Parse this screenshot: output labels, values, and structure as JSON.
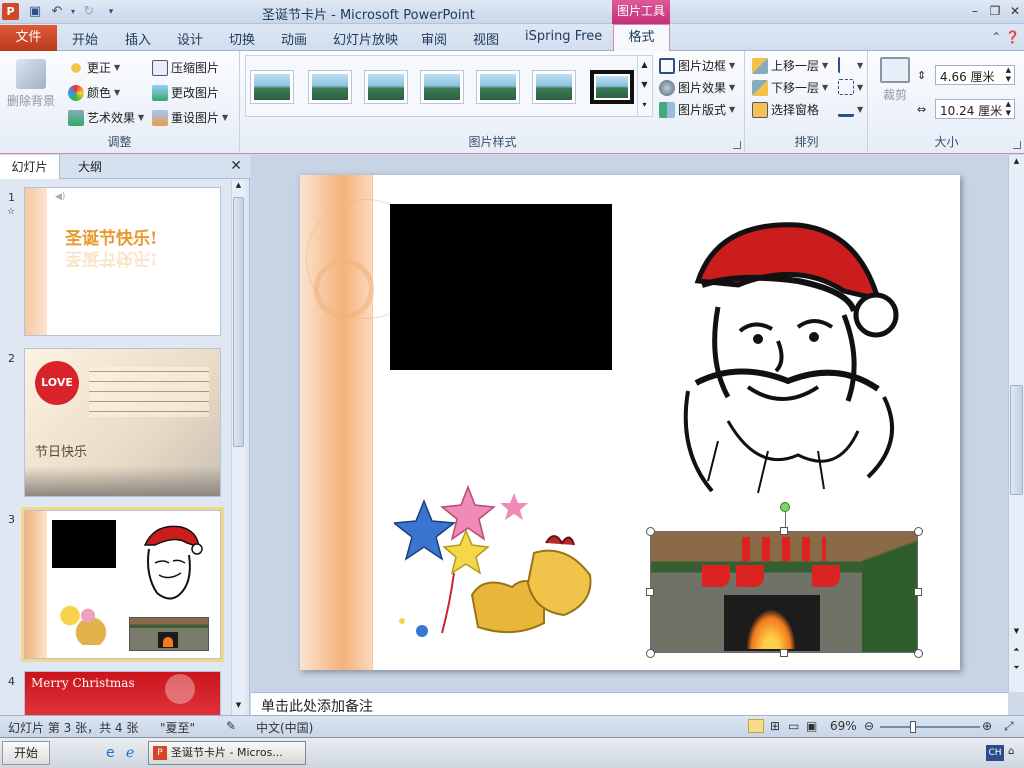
{
  "titlebar": {
    "window_title": "圣诞节卡片 - Microsoft PowerPoint",
    "context_tab_group": "图片工具",
    "app_icon_letter": "P"
  },
  "ribbon_tabs": [
    "文件",
    "开始",
    "插入",
    "设计",
    "切换",
    "动画",
    "幻灯片放映",
    "审阅",
    "视图",
    "iSpring Free",
    "格式"
  ],
  "ribbon": {
    "adjust": {
      "remove_bg": "删除背景",
      "corrections": "更正",
      "color": "颜色",
      "artistic": "艺术效果",
      "compress": "压缩图片",
      "change": "更改图片",
      "reset": "重设图片",
      "label": "调整"
    },
    "picture_styles": {
      "border": "图片边框",
      "effects": "图片效果",
      "layout": "图片版式",
      "label": "图片样式"
    },
    "arrange": {
      "bring_forward": "上移一层",
      "send_backward": "下移一层",
      "selection_pane": "选择窗格",
      "label": "排列"
    },
    "size": {
      "crop": "裁剪",
      "height": "4.66 厘米",
      "width": "10.24 厘米",
      "label": "大小"
    }
  },
  "left_panel": {
    "tabs": [
      "幻灯片",
      "大纲"
    ],
    "slides": [
      {
        "num": "1",
        "title": "圣诞节快乐!"
      },
      {
        "num": "2",
        "love_text": "LOVE",
        "script_text": "节日快乐"
      },
      {
        "num": "3"
      },
      {
        "num": "4",
        "title": "Merry Christmas"
      }
    ]
  },
  "notes": {
    "placeholder": "单击此处添加备注"
  },
  "statusbar": {
    "slide_info": "幻灯片 第 3 张，共 4 张",
    "theme": "\"夏至\"",
    "language": "中文(中国)",
    "zoom": "69%"
  },
  "taskbar": {
    "start": "开始",
    "task_ppt": "圣诞节卡片 - Micros...",
    "tray_lang": "CH"
  },
  "colors": {
    "file_tab": "#c8462a",
    "context_tab": "#c2307a",
    "ribbon_bg": "#eef3fa",
    "slide_left_band": "#f4b27a"
  }
}
